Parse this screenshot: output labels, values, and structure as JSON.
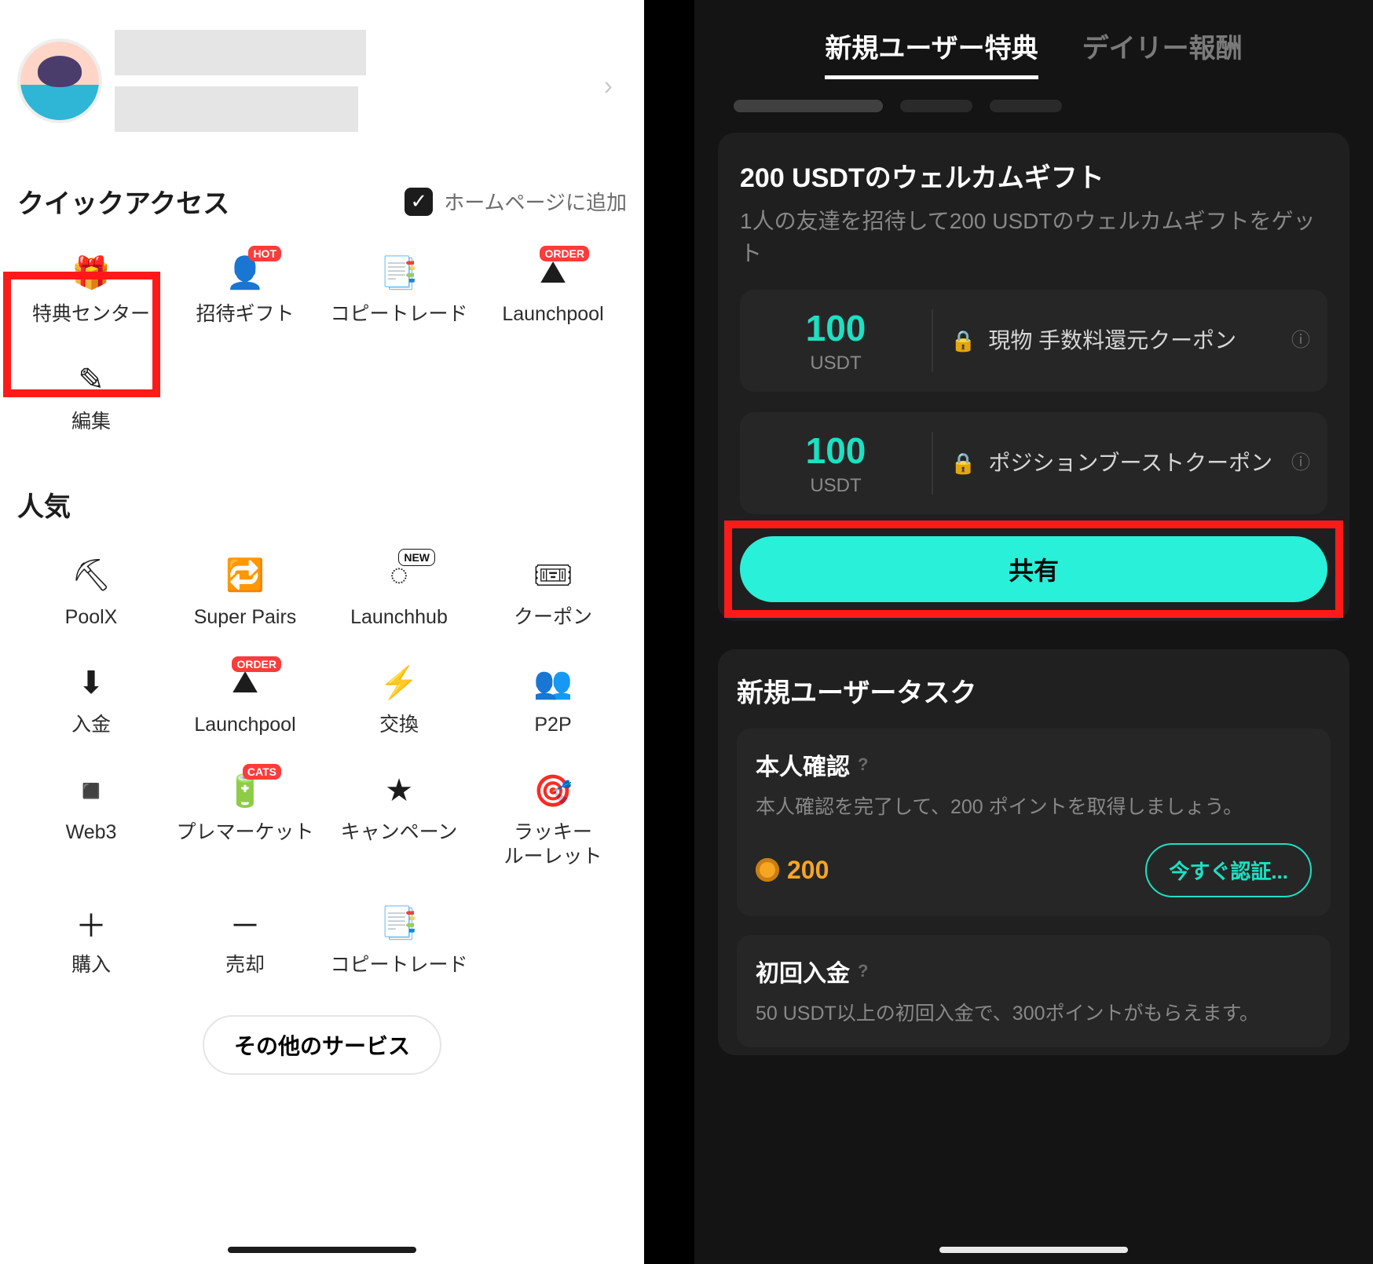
{
  "left": {
    "quick_access_title": "クイックアクセス",
    "add_to_homepage": "ホームページに追加",
    "quick_access": [
      {
        "name": "rewards-center",
        "label": "特典センター",
        "icon": "gift-icon",
        "badge": null
      },
      {
        "name": "invite-gift",
        "label": "招待ギフト",
        "icon": "invite-icon",
        "badge": "HOT"
      },
      {
        "name": "copy-trade",
        "label": "コピートレード",
        "icon": "copy-icon",
        "badge": null
      },
      {
        "name": "launchpool",
        "label": "Launchpool",
        "icon": "pool-icon",
        "badge": "ORDER"
      },
      {
        "name": "edit",
        "label": "編集",
        "icon": "edit-icon",
        "badge": null
      }
    ],
    "popular_title": "人気",
    "popular": [
      {
        "name": "poolx",
        "label": "PoolX",
        "icon": "pick-icon",
        "badge": null
      },
      {
        "name": "super-pairs",
        "label": "Super Pairs",
        "icon": "pairs-icon",
        "badge": null
      },
      {
        "name": "launchhub",
        "label": "Launchhub",
        "icon": "hub-icon",
        "badge": "NEW"
      },
      {
        "name": "coupon",
        "label": "クーポン",
        "icon": "ticket-icon",
        "badge": null
      },
      {
        "name": "deposit",
        "label": "入金",
        "icon": "deposit-icon",
        "badge": null
      },
      {
        "name": "launchpool2",
        "label": "Launchpool",
        "icon": "pool-icon",
        "badge": "ORDER"
      },
      {
        "name": "swap",
        "label": "交換",
        "icon": "swap-icon",
        "badge": null
      },
      {
        "name": "p2p",
        "label": "P2P",
        "icon": "p2p-icon",
        "badge": null
      },
      {
        "name": "web3",
        "label": "Web3",
        "icon": "web3-icon",
        "badge": null
      },
      {
        "name": "premarket",
        "label": "プレマーケット",
        "icon": "premarket-icon",
        "badge": "CATS"
      },
      {
        "name": "campaign",
        "label": "キャンペーン",
        "icon": "star-icon",
        "badge": null
      },
      {
        "name": "lucky",
        "label": "ラッキー\nルーレット",
        "icon": "roulette-icon",
        "badge": null
      },
      {
        "name": "buy",
        "label": "購入",
        "icon": "buy-icon",
        "badge": null
      },
      {
        "name": "sell",
        "label": "売却",
        "icon": "sell-icon",
        "badge": null
      },
      {
        "name": "copy-trade2",
        "label": "コピートレード",
        "icon": "copy-icon",
        "badge": null
      }
    ],
    "more_services": "その他のサービス"
  },
  "right": {
    "tabs": [
      {
        "name": "new-user-tab",
        "label": "新規ユーザー特典",
        "active": true
      },
      {
        "name": "daily-tab",
        "label": "デイリー報酬",
        "active": false
      }
    ],
    "welcome": {
      "title": "200 USDTのウェルカムギフト",
      "subtitle": "1人の友達を招待して200 USDTのウェルカムギフトをゲット",
      "coupons": [
        {
          "amount": "100",
          "unit": "USDT",
          "desc": "現物 手数料還元クーポン"
        },
        {
          "amount": "100",
          "unit": "USDT",
          "desc": "ポジションブーストクーポン"
        }
      ],
      "share_label": "共有"
    },
    "tasks": {
      "title": "新規ユーザータスク",
      "items": [
        {
          "name": "kyc-task",
          "title": "本人確認",
          "sub": "本人確認を完了して、200 ポイントを取得しましょう。",
          "points": "200",
          "cta": "今すぐ認証..."
        },
        {
          "name": "first-deposit-task",
          "title": "初回入金",
          "sub": "50 USDT以上の初回入金で、300ポイントがもらえます。"
        }
      ]
    }
  }
}
